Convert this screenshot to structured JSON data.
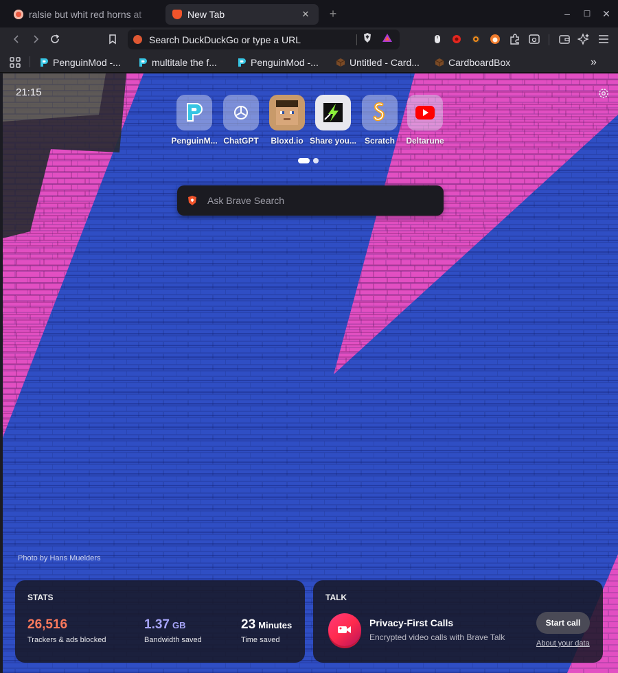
{
  "tabs": [
    {
      "title": "ralsie but whit red horns at",
      "active": false
    },
    {
      "title": "New Tab",
      "active": true
    }
  ],
  "window_controls": {
    "minimize": "–",
    "maximize": "☐",
    "close": "✕"
  },
  "toolbar": {
    "url_placeholder": "Search DuckDuckGo or type a URL"
  },
  "bookmarks": [
    {
      "label": "PenguinMod -...",
      "icon": "penguinmod-icon"
    },
    {
      "label": "multitale the f...",
      "icon": "penguinmod-icon"
    },
    {
      "label": "PenguinMod -...",
      "icon": "penguinmod-icon"
    },
    {
      "label": "Untitled - Card...",
      "icon": "cardboard-box-icon"
    },
    {
      "label": "CardboardBox",
      "icon": "cardboard-box-icon"
    }
  ],
  "newtab": {
    "clock": "21:15",
    "top_sites": [
      {
        "name": "PenguinM...",
        "icon": "penguinmod-icon"
      },
      {
        "name": "ChatGPT",
        "icon": "chatgpt-icon"
      },
      {
        "name": "Bloxd.io",
        "icon": "bloxd-icon"
      },
      {
        "name": "Share you...",
        "icon": "share-lightning-icon"
      },
      {
        "name": "Scratch",
        "icon": "scratch-icon"
      },
      {
        "name": "Deltarune",
        "icon": "youtube-icon"
      }
    ],
    "search_placeholder": "Ask Brave Search",
    "photo_credit": "Photo by Hans Muelders",
    "stats": {
      "title": "STATS",
      "trackers_value": "26,516",
      "trackers_label": "Trackers & ads blocked",
      "bandwidth_value": "1.37",
      "bandwidth_unit": "GB",
      "bandwidth_label": "Bandwidth saved",
      "time_value": "23",
      "time_unit": "Minutes",
      "time_label": "Time saved"
    },
    "talk": {
      "title": "TALK",
      "heading": "Privacy-First Calls",
      "subtitle": "Encrypted video calls with Brave Talk",
      "button": "Start call",
      "link": "About your data"
    }
  },
  "colors": {
    "wall_blue": "#2f4ec4",
    "wall_pink": "#e04fc0",
    "trackers": "#ff7a5c",
    "bandwidth": "#a6a4f8",
    "time": "#ffffff"
  }
}
